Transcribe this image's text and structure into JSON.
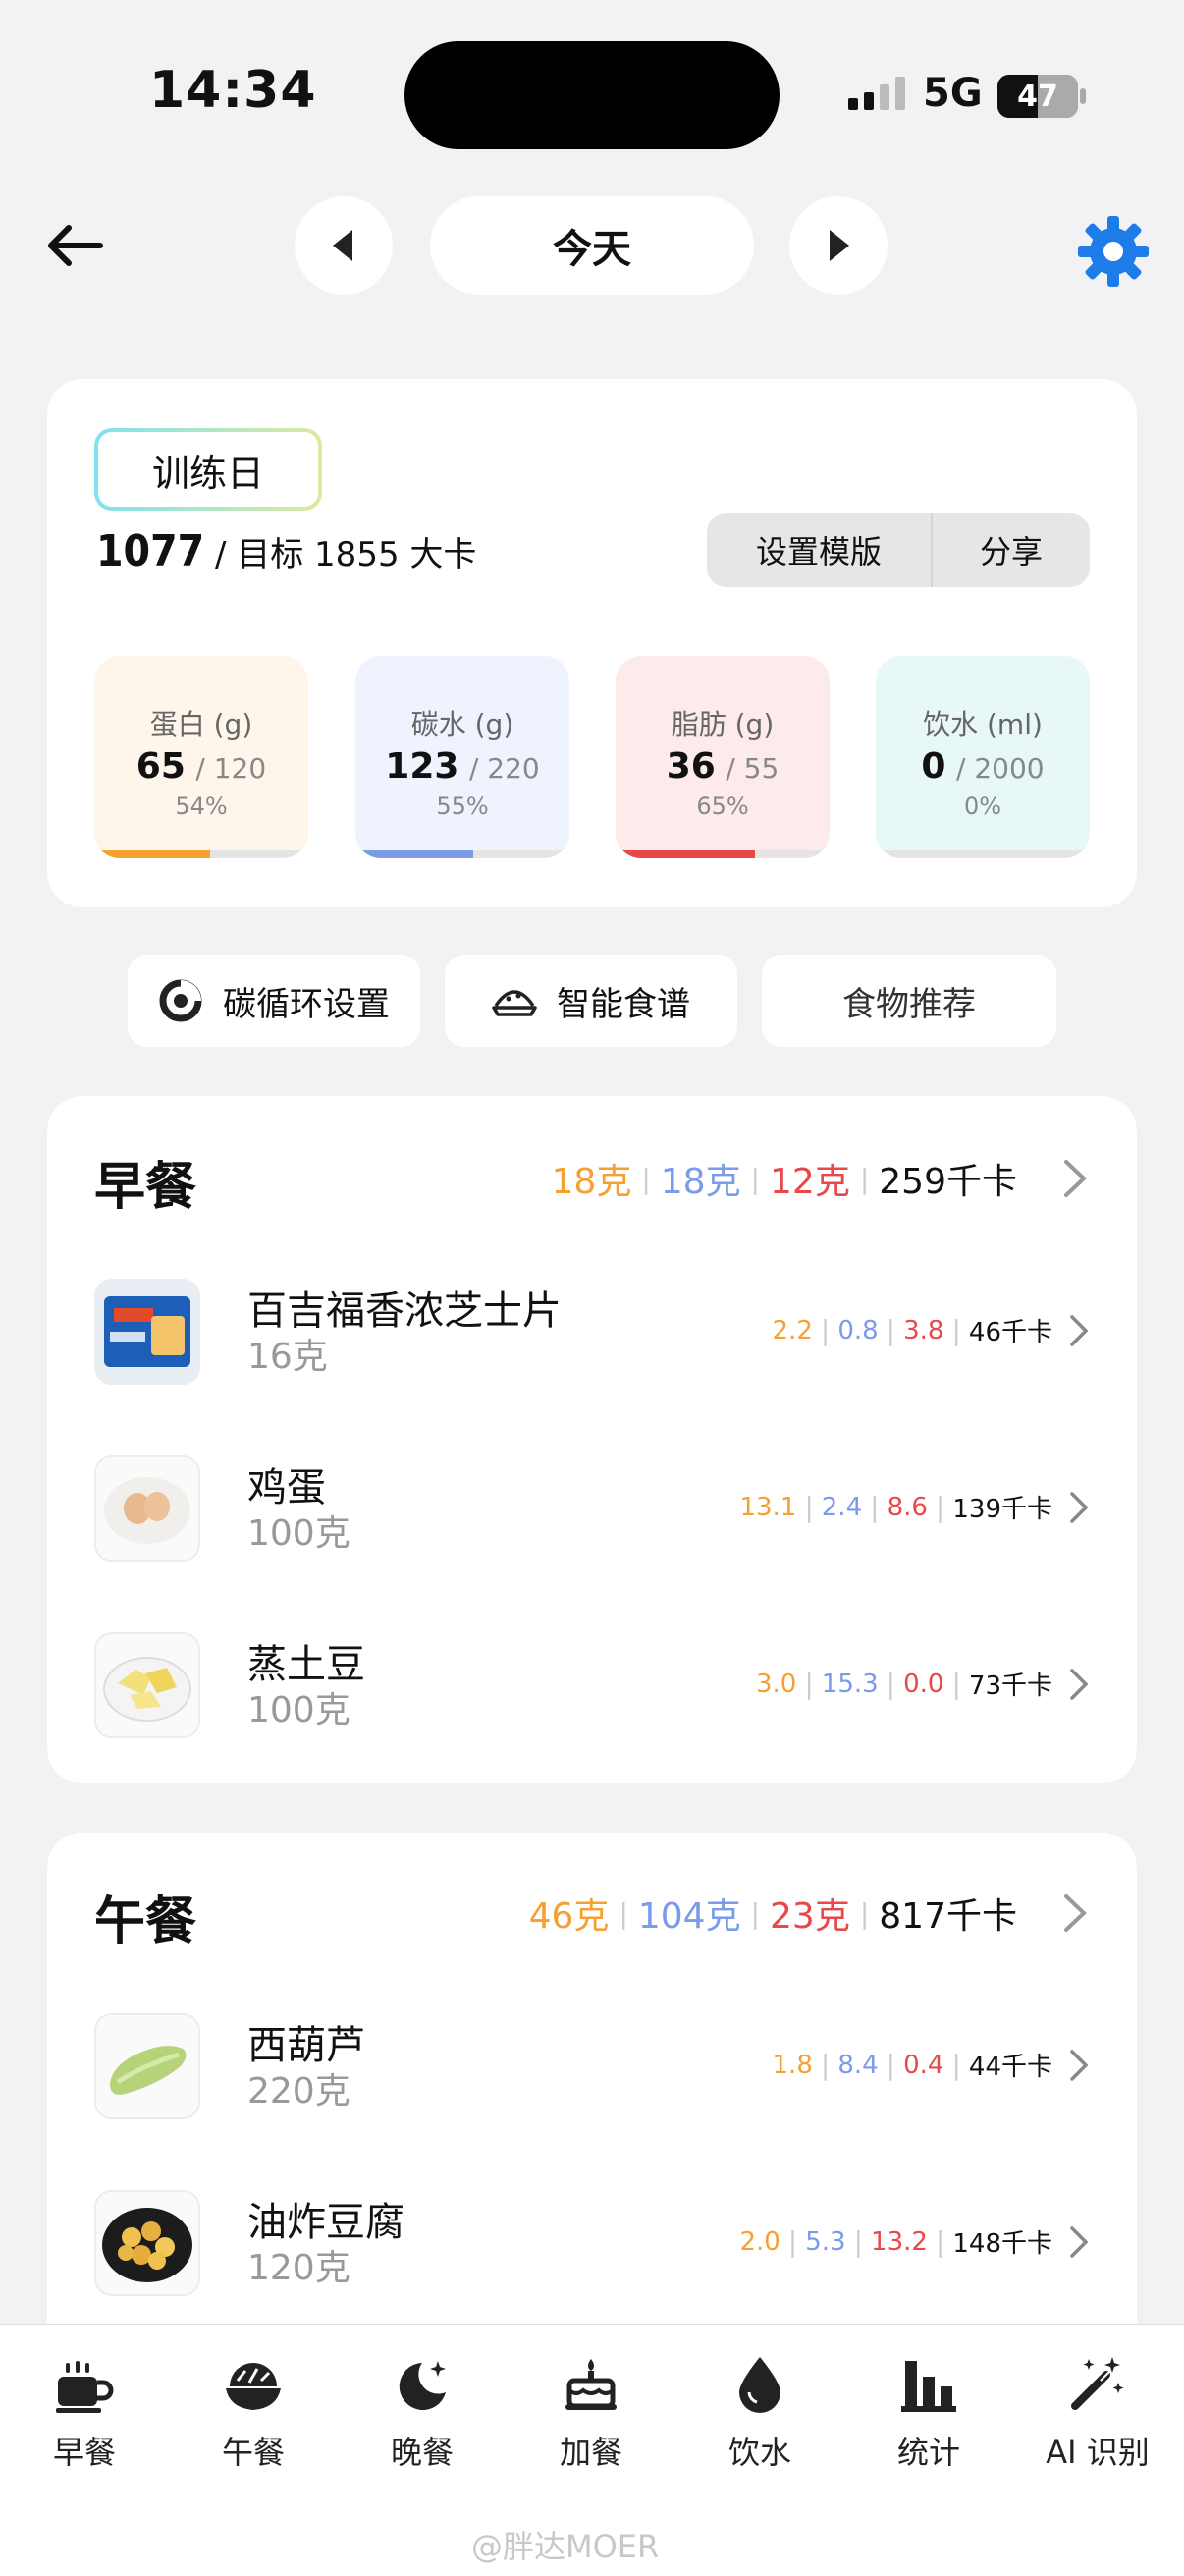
{
  "status": {
    "time": "14:34",
    "network": "5G",
    "battery": "47"
  },
  "nav": {
    "date_label": "今天",
    "back_icon": "arrow-left-icon",
    "settings_icon": "gear-icon",
    "accent": "#1e7ce8"
  },
  "summary": {
    "day_type": "训练日",
    "consumed": "1077",
    "target_text": "/ 目标 1855 大卡",
    "template_button": "设置模版",
    "share_button": "分享",
    "macros": [
      {
        "label": "蛋白 (g)",
        "value": "65",
        "target": "/ 120",
        "percent": "54%",
        "fraction": 0.54,
        "bg": "#fef6ea",
        "bar": "#f5a030"
      },
      {
        "label": "碳水 (g)",
        "value": "123",
        "target": "/ 220",
        "percent": "55%",
        "fraction": 0.55,
        "bg": "#eef3fe",
        "bar": "#7a9be8"
      },
      {
        "label": "脂肪 (g)",
        "value": "36",
        "target": "/ 55",
        "percent": "65%",
        "fraction": 0.65,
        "bg": "#fdeaea",
        "bar": "#e84848"
      },
      {
        "label": "饮水 (ml)",
        "value": "0",
        "target": "/ 2000",
        "percent": "0%",
        "fraction": 0,
        "bg": "#e8f8f7",
        "bar": "#4cc9c0"
      }
    ]
  },
  "actions": {
    "carb_cycle": "碳循环设置",
    "smart_recipe": "智能食谱",
    "food_recommend": "食物推荐"
  },
  "breakfast": {
    "title": "早餐",
    "protein": "18克",
    "carbs": "18克",
    "fat": "12克",
    "kcal": "259千卡",
    "items": [
      {
        "name": "百吉福香浓芝士片",
        "qty": "16克",
        "p": "2.2",
        "c": "0.8",
        "f": "3.8",
        "kcal": "46千卡"
      },
      {
        "name": "鸡蛋",
        "qty": "100克",
        "p": "13.1",
        "c": "2.4",
        "f": "8.6",
        "kcal": "139千卡"
      },
      {
        "name": "蒸土豆",
        "qty": "100克",
        "p": "3.0",
        "c": "15.3",
        "f": "0.0",
        "kcal": "73千卡"
      }
    ]
  },
  "lunch": {
    "title": "午餐",
    "protein": "46克",
    "carbs": "104克",
    "fat": "23克",
    "kcal": "817千卡",
    "items": [
      {
        "name": "西葫芦",
        "qty": "220克",
        "p": "1.8",
        "c": "8.4",
        "f": "0.4",
        "kcal": "44千卡"
      },
      {
        "name": "油炸豆腐",
        "qty": "120克",
        "p": "2.0",
        "c": "5.3",
        "f": "13.2",
        "kcal": "148千卡"
      }
    ]
  },
  "tabs": [
    {
      "label": "早餐",
      "icon": "coffee-cup-icon"
    },
    {
      "label": "午餐",
      "icon": "bowl-icon"
    },
    {
      "label": "晚餐",
      "icon": "moon-icon"
    },
    {
      "label": "加餐",
      "icon": "cake-icon"
    },
    {
      "label": "饮水",
      "icon": "water-drop-icon"
    },
    {
      "label": "统计",
      "icon": "bar-chart-icon"
    },
    {
      "label": "AI 识别",
      "icon": "magic-wand-icon"
    }
  ],
  "watermark": "@胖达MOER"
}
